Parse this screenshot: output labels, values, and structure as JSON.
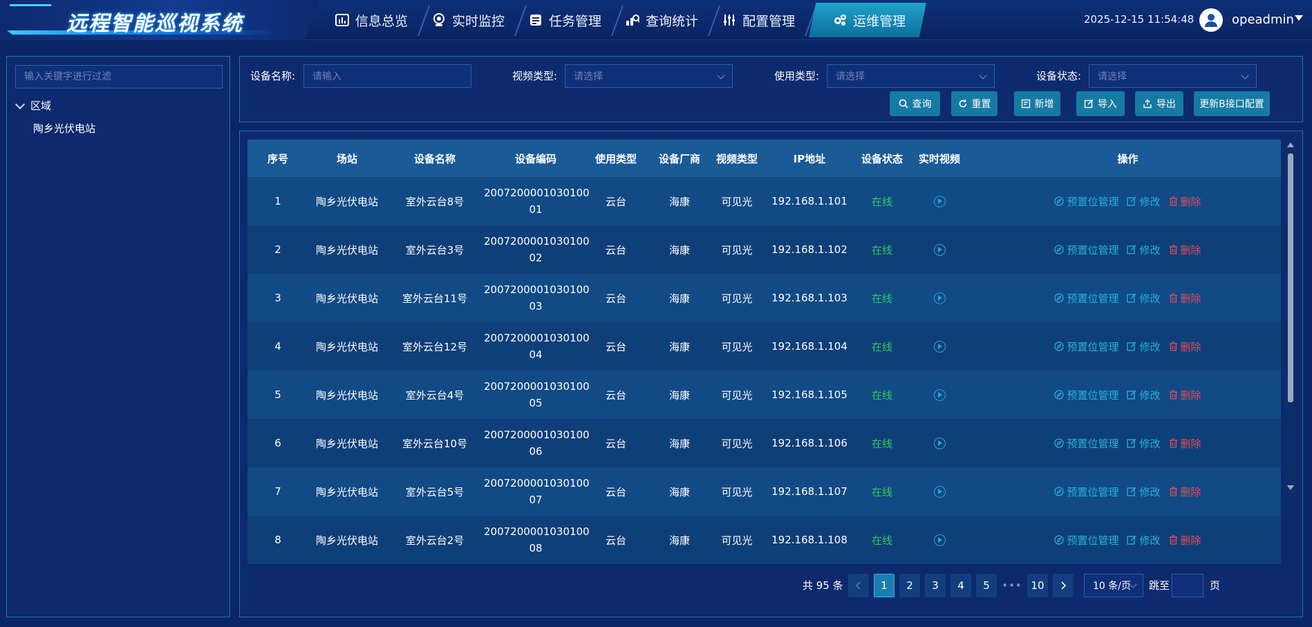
{
  "app": {
    "title": "远程智能巡视系统"
  },
  "nav": [
    {
      "label": "信息总览",
      "icon": "bar-chart-icon",
      "active": false
    },
    {
      "label": "实时监控",
      "icon": "webcam-icon",
      "active": false
    },
    {
      "label": "任务管理",
      "icon": "task-list-icon",
      "active": false
    },
    {
      "label": "查询统计",
      "icon": "stats-icon",
      "active": false
    },
    {
      "label": "配置管理",
      "icon": "sliders-icon",
      "active": false
    },
    {
      "label": "运维管理",
      "icon": "gears-icon",
      "active": true
    }
  ],
  "header": {
    "datetime": "2025-12-15 11:54:48",
    "username": "opeadmin"
  },
  "sidebar": {
    "filter_placeholder": "输入关键字进行过滤",
    "tree_root": "区域",
    "tree_child": "陶乡光伏电站"
  },
  "search": {
    "device_name_label": "设备名称:",
    "device_name_placeholder": "请输入",
    "video_type_label": "视频类型:",
    "video_type_placeholder": "请选择",
    "use_type_label": "使用类型:",
    "use_type_placeholder": "请选择",
    "device_status_label": "设备状态:",
    "device_status_placeholder": "请选择"
  },
  "toolbar": {
    "query": "查询",
    "reset": "重置",
    "add": "新增",
    "import": "导入",
    "export": "导出",
    "update_b": "更新B接口配置"
  },
  "table": {
    "headers": [
      "序号",
      "场站",
      "设备名称",
      "设备编码",
      "使用类型",
      "设备厂商",
      "视频类型",
      "IP地址",
      "设备状态",
      "实时视频",
      "操作"
    ],
    "ops": {
      "preset": "预置位管理",
      "edit": "修改",
      "delete": "删除"
    },
    "rows": [
      {
        "no": "1",
        "station": "陶乡光伏电站",
        "name": "室外云台8号",
        "code1": "2007200001030100",
        "code2": "01",
        "use": "云台",
        "vendor": "海康",
        "video": "可见光",
        "ip": "192.168.1.101",
        "status": "在线"
      },
      {
        "no": "2",
        "station": "陶乡光伏电站",
        "name": "室外云台3号",
        "code1": "2007200001030100",
        "code2": "02",
        "use": "云台",
        "vendor": "海康",
        "video": "可见光",
        "ip": "192.168.1.102",
        "status": "在线"
      },
      {
        "no": "3",
        "station": "陶乡光伏电站",
        "name": "室外云台11号",
        "code1": "2007200001030100",
        "code2": "03",
        "use": "云台",
        "vendor": "海康",
        "video": "可见光",
        "ip": "192.168.1.103",
        "status": "在线"
      },
      {
        "no": "4",
        "station": "陶乡光伏电站",
        "name": "室外云台12号",
        "code1": "2007200001030100",
        "code2": "04",
        "use": "云台",
        "vendor": "海康",
        "video": "可见光",
        "ip": "192.168.1.104",
        "status": "在线"
      },
      {
        "no": "5",
        "station": "陶乡光伏电站",
        "name": "室外云台4号",
        "code1": "2007200001030100",
        "code2": "05",
        "use": "云台",
        "vendor": "海康",
        "video": "可见光",
        "ip": "192.168.1.105",
        "status": "在线"
      },
      {
        "no": "6",
        "station": "陶乡光伏电站",
        "name": "室外云台10号",
        "code1": "2007200001030100",
        "code2": "06",
        "use": "云台",
        "vendor": "海康",
        "video": "可见光",
        "ip": "192.168.1.106",
        "status": "在线"
      },
      {
        "no": "7",
        "station": "陶乡光伏电站",
        "name": "室外云台5号",
        "code1": "2007200001030100",
        "code2": "07",
        "use": "云台",
        "vendor": "海康",
        "video": "可见光",
        "ip": "192.168.1.107",
        "status": "在线"
      },
      {
        "no": "8",
        "station": "陶乡光伏电站",
        "name": "室外云台2号",
        "code1": "2007200001030100",
        "code2": "08",
        "use": "云台",
        "vendor": "海康",
        "video": "可见光",
        "ip": "192.168.1.108",
        "status": "在线"
      }
    ]
  },
  "pagination": {
    "total": "共 95 条",
    "pages": [
      "1",
      "2",
      "3",
      "4",
      "5",
      "10"
    ],
    "current": "1",
    "ellipsis": "•••",
    "page_size": "10 条/页",
    "goto_label": "跳至",
    "goto_suffix": "页"
  },
  "colors": {
    "online": "#2ecc5b",
    "link": "#22b3d9",
    "danger": "#e04c5a",
    "accent": "#177aa3"
  }
}
